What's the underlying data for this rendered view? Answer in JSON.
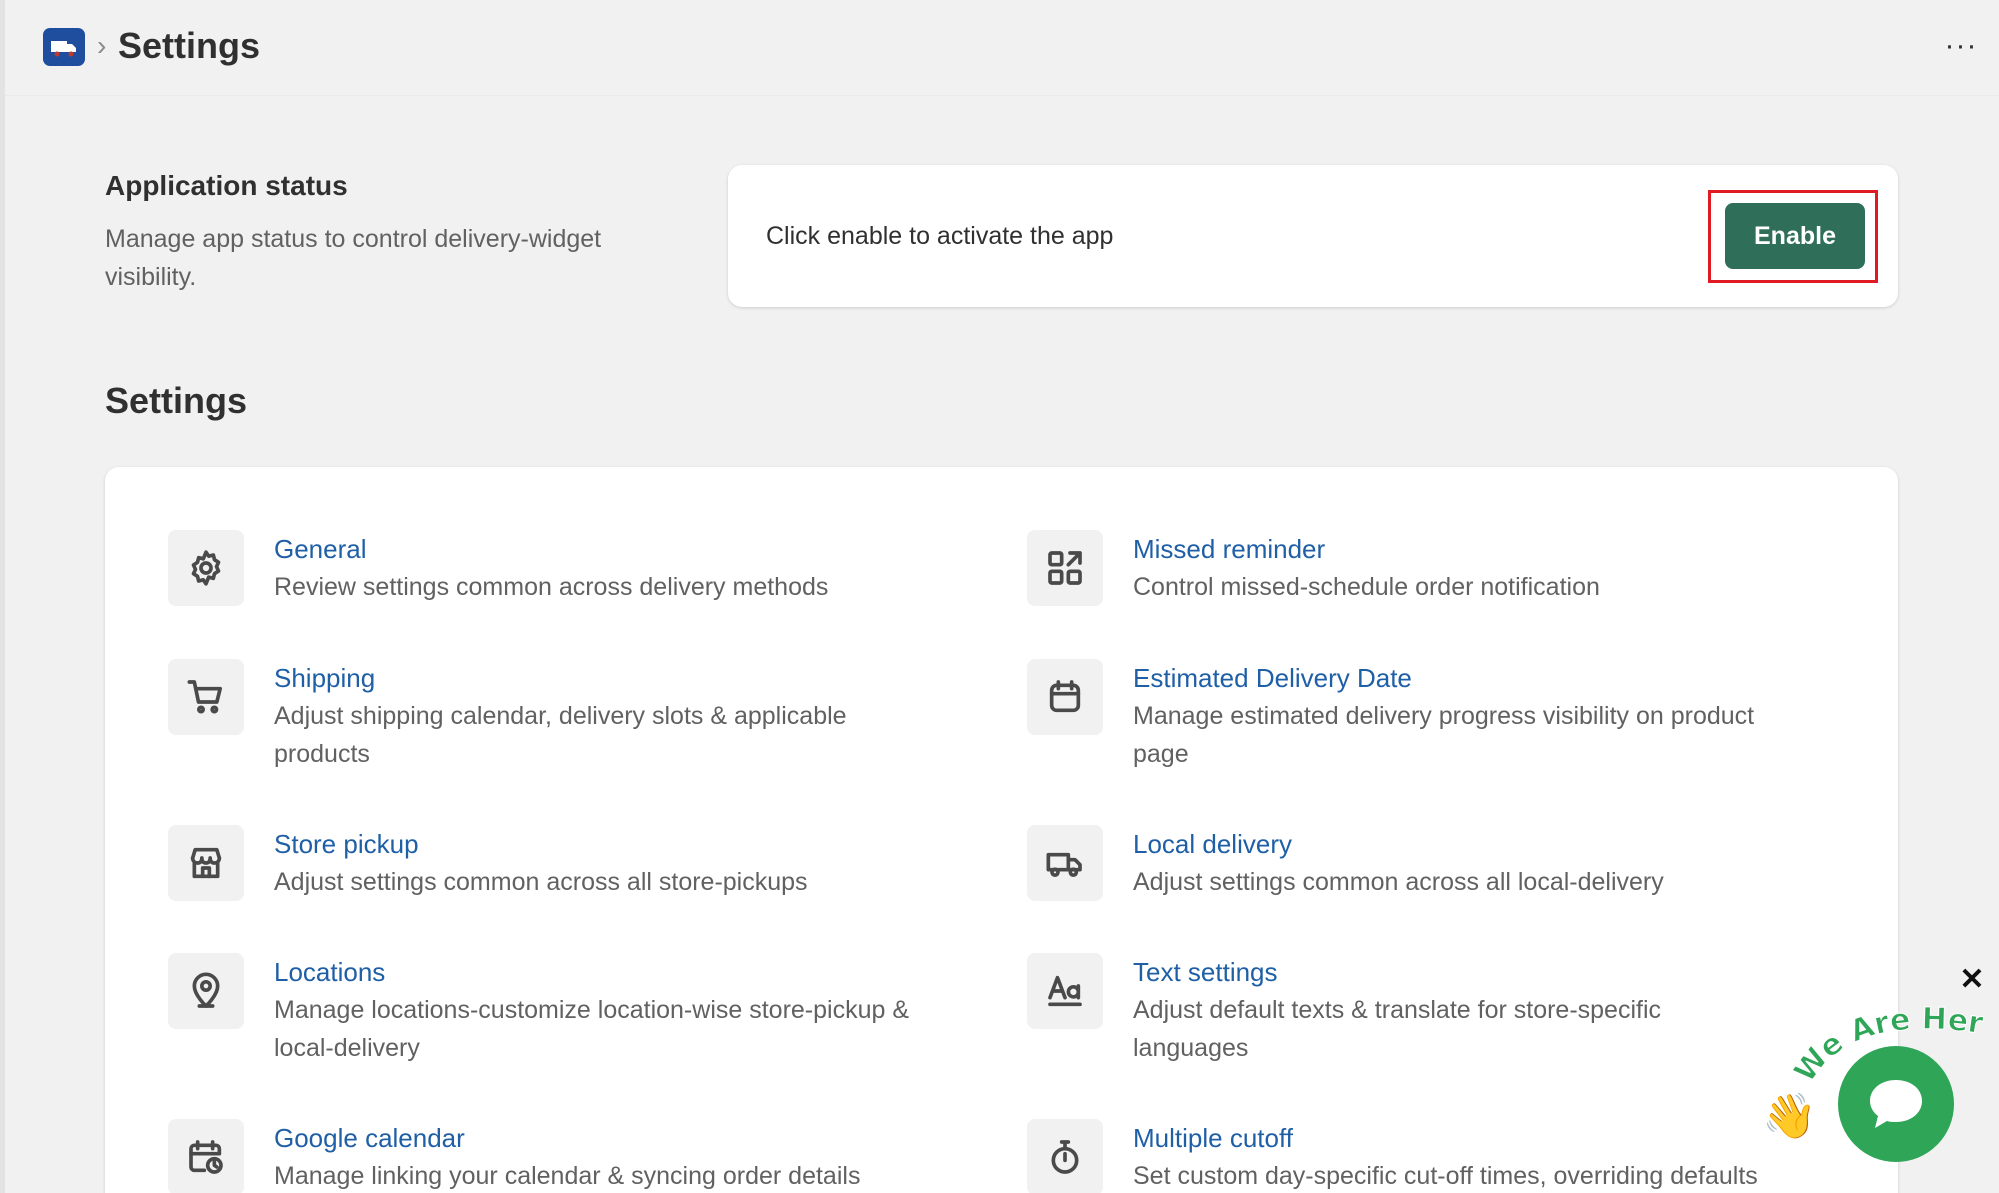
{
  "header": {
    "breadcrumb_sep": "›",
    "title": "Settings",
    "more_label": "···",
    "app_icon": "delivery-truck-icon"
  },
  "app_status": {
    "heading": "Application status",
    "description": "Manage app status to control delivery-widget visibility.",
    "card_text": "Click enable to activate the app",
    "enable_label": "Enable",
    "button_color": "#2f6f5a",
    "highlight_color": "#e01b24"
  },
  "settings": {
    "heading": "Settings",
    "items": [
      {
        "icon": "gear-icon",
        "title": "General",
        "desc": "Review settings common across delivery methods"
      },
      {
        "icon": "apps-icon",
        "title": "Missed reminder",
        "desc": "Control missed-schedule order notification"
      },
      {
        "icon": "cart-icon",
        "title": "Shipping",
        "desc": "Adjust shipping calendar, delivery slots & applicable products"
      },
      {
        "icon": "calendar-icon",
        "title": "Estimated Delivery Date",
        "desc": "Manage estimated delivery progress visibility on product page"
      },
      {
        "icon": "store-icon",
        "title": "Store pickup",
        "desc": "Adjust settings common across all store-pickups"
      },
      {
        "icon": "truck-icon",
        "title": "Local delivery",
        "desc": "Adjust settings common across all local-delivery"
      },
      {
        "icon": "location-pin-icon",
        "title": "Locations",
        "desc": "Manage locations-customize location-wise store-pickup & local-delivery"
      },
      {
        "icon": "text-icon",
        "title": "Text settings",
        "desc": "Adjust default texts & translate for store-specific languages"
      },
      {
        "icon": "calendar-clock-icon",
        "title": "Google calendar",
        "desc": "Manage linking your calendar & syncing order details"
      },
      {
        "icon": "stopwatch-icon",
        "title": "Multiple cutoff",
        "desc": "Set custom day-specific cut-off times, overriding defaults"
      }
    ]
  },
  "chat": {
    "tag_text": "We Are Here!",
    "close_label": "✕",
    "wave_emoji": "👋",
    "color": "#2fa657"
  }
}
